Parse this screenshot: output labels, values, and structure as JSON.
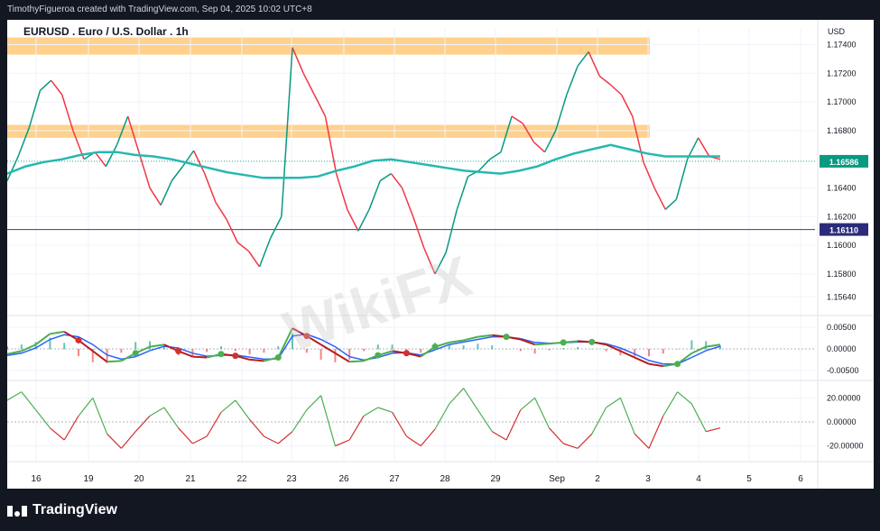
{
  "header": {
    "attribution": "TimothyFigueroa created with TradingView.com, Sep 04, 2025 10:02 UTC+8"
  },
  "chart_data": {
    "type": "line",
    "title": "EURUSD . Euro / U.S. Dollar . 1h",
    "currency": "USD",
    "price_axis": {
      "ticks": [
        "1.17400",
        "1.17200",
        "1.17000",
        "1.16800",
        "1.16400",
        "1.16200",
        "1.16000",
        "1.15800",
        "1.15640"
      ],
      "current_price": "1.16586",
      "marked_price": "1.16110",
      "ylim": [
        1.1556,
        1.1751
      ]
    },
    "x_axis": {
      "ticks": [
        "16",
        "19",
        "20",
        "21",
        "22",
        "23",
        "26",
        "27",
        "28",
        "29",
        "Sep",
        "2",
        "3",
        "4",
        "5",
        "6"
      ]
    },
    "resistance_zones": [
      [
        1.1733,
        1.1745
      ],
      [
        1.1675,
        1.1684
      ]
    ],
    "price_series": [
      1.1645,
      1.1662,
      1.1682,
      1.1708,
      1.1715,
      1.1705,
      1.168,
      1.166,
      1.1665,
      1.1655,
      1.167,
      1.169,
      1.1665,
      1.164,
      1.1628,
      1.1645,
      1.1655,
      1.1666,
      1.165,
      1.163,
      1.1618,
      1.1602,
      1.1596,
      1.1585,
      1.1605,
      1.162,
      1.1738,
      1.172,
      1.1705,
      1.169,
      1.165,
      1.1625,
      1.161,
      1.1625,
      1.1645,
      1.165,
      1.164,
      1.162,
      1.1598,
      1.158,
      1.1595,
      1.1625,
      1.1648,
      1.1652,
      1.166,
      1.1665,
      1.169,
      1.1685,
      1.1672,
      1.1665,
      1.168,
      1.1705,
      1.1725,
      1.1735,
      1.1718,
      1.1712,
      1.1705,
      1.169,
      1.1658,
      1.164,
      1.1625,
      1.1632,
      1.166,
      1.1675,
      1.1662,
      1.166
    ],
    "moving_average": [
      1.165,
      1.1655,
      1.1658,
      1.166,
      1.1663,
      1.1665,
      1.1665,
      1.1663,
      1.1662,
      1.166,
      1.1657,
      1.1654,
      1.1651,
      1.1649,
      1.1647,
      1.1647,
      1.1647,
      1.1648,
      1.1652,
      1.1655,
      1.1659,
      1.166,
      1.1658,
      1.1656,
      1.1654,
      1.1652,
      1.1651,
      1.165,
      1.1652,
      1.1655,
      1.166,
      1.1664,
      1.1667,
      1.167,
      1.1667,
      1.1664,
      1.1662,
      1.1662,
      1.1662,
      1.1662
    ],
    "oscillator1": {
      "ticks": [
        "0.00500",
        "0.00000",
        "-0.00500"
      ],
      "ylim": [
        -0.0065,
        0.0065
      ],
      "fast": [
        -0.0012,
        -0.0005,
        0.001,
        0.0035,
        0.004,
        0.002,
        -0.0005,
        -0.003,
        -0.0028,
        -0.001,
        0.0005,
        0.001,
        -0.0005,
        -0.0018,
        -0.002,
        -0.0012,
        -0.0016,
        -0.0025,
        -0.0028,
        -0.002,
        0.0048,
        0.003,
        0.001,
        -0.001,
        -0.003,
        -0.0028,
        -0.0015,
        -0.0005,
        -0.001,
        -0.0018,
        0.0005,
        0.0015,
        0.002,
        0.0028,
        0.0032,
        0.0028,
        0.0022,
        0.001,
        0.0012,
        0.0015,
        0.0018,
        0.0016,
        0.001,
        -0.0005,
        -0.002,
        -0.0035,
        -0.004,
        -0.0035,
        -0.001,
        0.0005,
        0.001
      ],
      "slow": [
        -0.0015,
        -0.001,
        0.0002,
        0.0022,
        0.0033,
        0.0028,
        0.001,
        -0.0014,
        -0.0024,
        -0.0018,
        -0.0004,
        0.0006,
        0.0002,
        -0.001,
        -0.0017,
        -0.0015,
        -0.0014,
        -0.0019,
        -0.0024,
        -0.0023,
        0.003,
        0.0034,
        0.0022,
        0.0005,
        -0.0018,
        -0.0026,
        -0.002,
        -0.001,
        -0.0009,
        -0.0014,
        -0.0002,
        0.001,
        0.0016,
        0.0022,
        0.0028,
        0.0028,
        0.0024,
        0.0015,
        0.0013,
        0.0014,
        0.0016,
        0.0016,
        0.0012,
        0.0002,
        -0.0012,
        -0.0027,
        -0.0035,
        -0.0035,
        -0.002,
        -0.0004,
        0.0006
      ]
    },
    "oscillator2": {
      "ticks": [
        "20.00000",
        "0.00000",
        "-20.00000"
      ],
      "ylim": [
        -30,
        30
      ],
      "values": [
        18,
        25,
        10,
        -5,
        -15,
        5,
        20,
        -10,
        -22,
        -8,
        5,
        12,
        -5,
        -18,
        -12,
        8,
        18,
        2,
        -12,
        -18,
        -8,
        10,
        22,
        -20,
        -15,
        5,
        12,
        8,
        -12,
        -20,
        -6,
        15,
        28,
        10,
        -8,
        -15,
        10,
        20,
        -5,
        -18,
        -22,
        -10,
        12,
        20,
        -10,
        -22,
        5,
        25,
        15,
        -8,
        -5
      ]
    }
  },
  "watermark": "WikiFX",
  "footer": {
    "brand": "TradingView"
  }
}
